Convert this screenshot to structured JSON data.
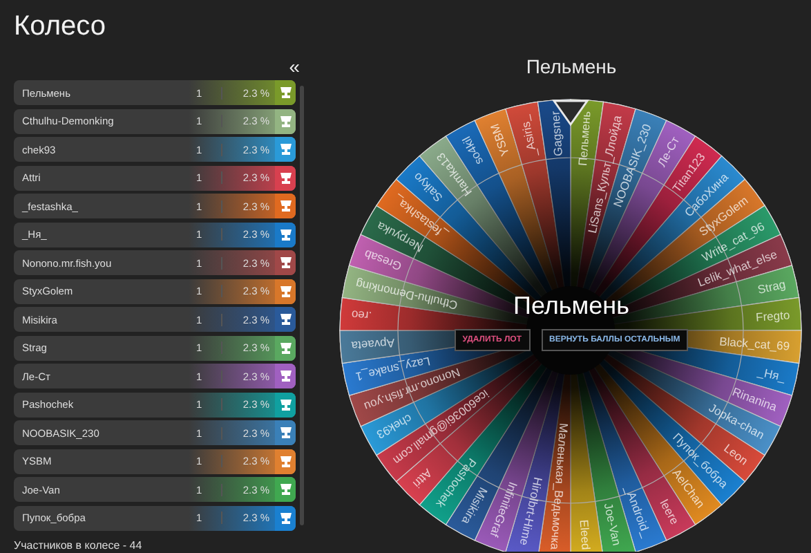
{
  "title": "Колесо",
  "collapse_button": "«",
  "participants": [
    {
      "name": "Пельмень",
      "count": "1",
      "percent": "2.3 %",
      "color": "#7a9a2a"
    },
    {
      "name": "Cthulhu-Demonking",
      "count": "1",
      "percent": "2.3 %",
      "color": "#93b482"
    },
    {
      "name": "chek93",
      "count": "1",
      "percent": "2.3 %",
      "color": "#2a9ad8"
    },
    {
      "name": "Attri",
      "count": "1",
      "percent": "2.3 %",
      "color": "#d8404f"
    },
    {
      "name": "_festashka_",
      "count": "1",
      "percent": "2.3 %",
      "color": "#e06a20"
    },
    {
      "name": "_Ня_",
      "count": "1",
      "percent": "2.3 %",
      "color": "#1a7ac8"
    },
    {
      "name": "Nonono.mr.fish.you",
      "count": "1",
      "percent": "2.3 %",
      "color": "#a04848"
    },
    {
      "name": "StyxGolem",
      "count": "1",
      "percent": "2.3 %",
      "color": "#d8772a"
    },
    {
      "name": "Misikira",
      "count": "1",
      "percent": "2.3 %",
      "color": "#2a5a9a"
    },
    {
      "name": "Strag",
      "count": "1",
      "percent": "2.3 %",
      "color": "#5aa860"
    },
    {
      "name": "Ле-Ст",
      "count": "1",
      "percent": "2.3 %",
      "color": "#a060c0"
    },
    {
      "name": "Pashochek",
      "count": "1",
      "percent": "2.3 %",
      "color": "#10a0a0"
    },
    {
      "name": "NOOBASIK_230",
      "count": "1",
      "percent": "2.3 %",
      "color": "#3a80b8"
    },
    {
      "name": "YSBM",
      "count": "1",
      "percent": "2.3 %",
      "color": "#e08030"
    },
    {
      "name": "Joe-Van",
      "count": "1",
      "percent": "2.3 %",
      "color": "#40a850"
    },
    {
      "name": "Пупок_бобра",
      "count": "1",
      "percent": "2.3 %",
      "color": "#1a80d0"
    }
  ],
  "footer": "Участников в колесе - 44",
  "wheel": {
    "winner_title": "Пельмень",
    "center_title": "Пельмень",
    "delete_button": "УДАЛИТЬ ЛОТ",
    "return_button": "ВЕРНУТЬ БАЛЛЫ ОСТАЛЬНЫМ",
    "segments": [
      {
        "label": "Пельмень",
        "color": "#7a9a2a"
      },
      {
        "label": "LiSans_Культ_Ллойда",
        "color": "#c23a48"
      },
      {
        "label": "NOOBASIK_230",
        "color": "#3a80b8"
      },
      {
        "label": "Ле-Ст",
        "color": "#a060c0"
      },
      {
        "label": "Titan123",
        "color": "#d02a50"
      },
      {
        "label": "СабоХина",
        "color": "#2a8ad0"
      },
      {
        "label": "StyxGolem",
        "color": "#d8772a"
      },
      {
        "label": "Write_cat_96",
        "color": "#2a9a6a"
      },
      {
        "label": "Lelik_what_else",
        "color": "#8a3a4a"
      },
      {
        "label": "Strag",
        "color": "#5aa860"
      },
      {
        "label": "Fregto",
        "color": "#7a9a2a"
      },
      {
        "label": "Black_cat_69",
        "color": "#d8a030"
      },
      {
        "label": "_Ня_",
        "color": "#1a7ac8"
      },
      {
        "label": "Rinanina",
        "color": "#a060c0"
      },
      {
        "label": "Jopka-chan",
        "color": "#4a90c8"
      },
      {
        "label": "Leon",
        "color": "#d84a3a"
      },
      {
        "label": "Пупок_бобра",
        "color": "#1a80d0"
      },
      {
        "label": "AelChan",
        "color": "#e08a20"
      },
      {
        "label": "leere",
        "color": "#c83a5a"
      },
      {
        "label": "_Android_",
        "color": "#2a7ad0"
      },
      {
        "label": "Joe-Van",
        "color": "#40a850"
      },
      {
        "label": "Eleed",
        "color": "#d8b020"
      },
      {
        "label": "Маленькая_Ведьмочка",
        "color": "#e0602a"
      },
      {
        "label": "Hirolbrt-Hime",
        "color": "#5a5ac8"
      },
      {
        "label": "InfiniteGraf",
        "color": "#9a5ab8"
      },
      {
        "label": "Misikira",
        "color": "#2a5a9a"
      },
      {
        "label": "Pashochek",
        "color": "#10a08a"
      },
      {
        "label": "Attri",
        "color": "#d8404f"
      },
      {
        "label": "ice60036i@gmail.com",
        "color": "#c83a4a"
      },
      {
        "label": "chek93",
        "color": "#2a9ad8"
      },
      {
        "label": "Nonono.mr.fish.you",
        "color": "#a04848"
      },
      {
        "label": "Lazy_snake_1",
        "color": "#2a7ad0"
      },
      {
        "label": "Apvaeta",
        "color": "#4a7a9a"
      },
      {
        "label": ".reo",
        "color": "#d03a3a"
      },
      {
        "label": "Cthulhu-Demonking",
        "color": "#93b482"
      },
      {
        "label": "Gresab",
        "color": "#c060b0"
      },
      {
        "label": "Nerpyuka",
        "color": "#2a6a4a"
      },
      {
        "label": "_festashka_",
        "color": "#e06a20"
      },
      {
        "label": "Saikyo",
        "color": "#1a7ac8"
      },
      {
        "label": "Hamka13",
        "color": "#8aaa8a"
      },
      {
        "label": "so4kil",
        "color": "#1a6ab8"
      },
      {
        "label": "YSBM",
        "color": "#e08030"
      },
      {
        "label": "_Asiris_",
        "color": "#d04a3a"
      },
      {
        "label": "Gagsner",
        "color": "#1a4a8a"
      }
    ]
  }
}
